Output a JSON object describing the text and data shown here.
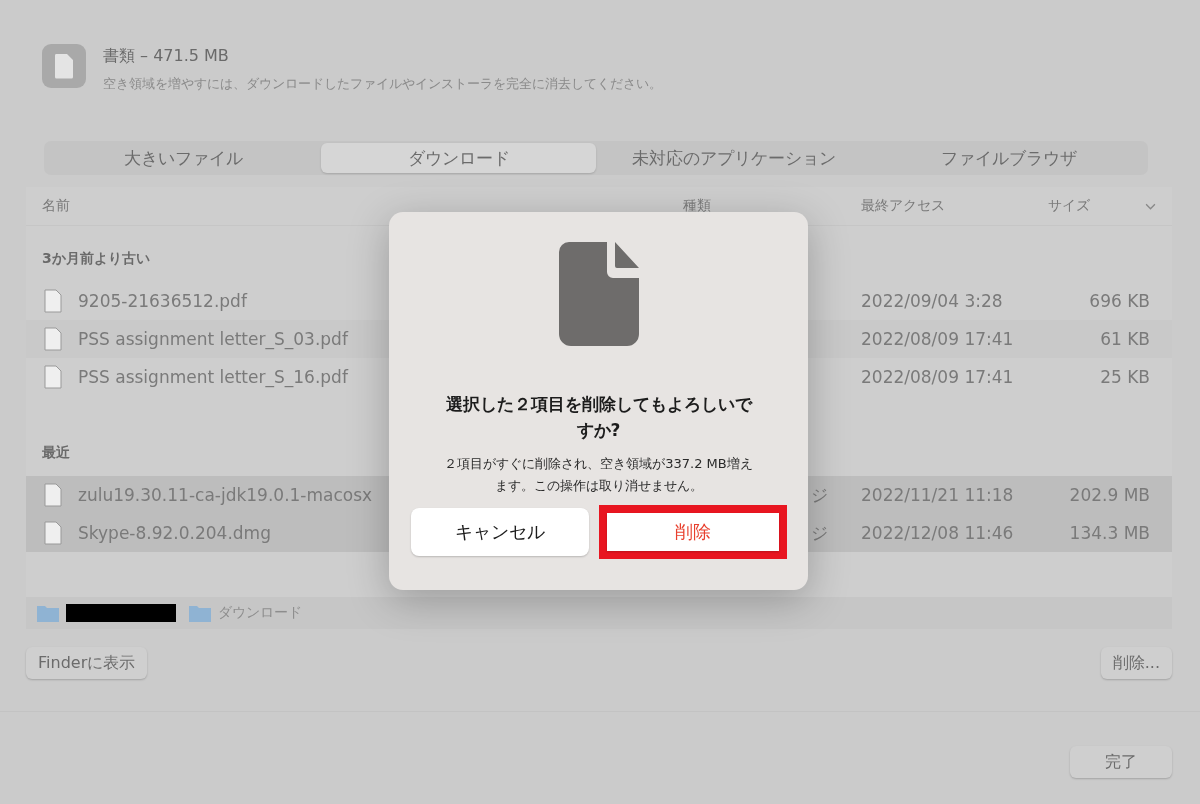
{
  "header": {
    "title": "書類 – 471.5 MB",
    "subtitle": "空き領域を増やすには、ダウンロードしたファイルやインストーラを完全に消去してください。"
  },
  "tabs": [
    {
      "label": "大きいファイル",
      "selected": false
    },
    {
      "label": "ダウンロード",
      "selected": true
    },
    {
      "label": "未対応のアプリケーション",
      "selected": false
    },
    {
      "label": "ファイルブラウザ",
      "selected": false
    }
  ],
  "table": {
    "columns": [
      "名前",
      "種類",
      "最終アクセス",
      "サイズ"
    ],
    "groups": [
      {
        "title": "3か月前より古い",
        "rows": [
          {
            "name": "9205-21636512.pdf",
            "kind": "",
            "accessed": "2022/09/04 3:28",
            "size": "696 KB",
            "selected": false
          },
          {
            "name": "PSS assignment letter_S_03.pdf",
            "kind": "",
            "accessed": "2022/08/09 17:41",
            "size": "61 KB",
            "selected": false
          },
          {
            "name": "PSS assignment letter_S_16.pdf",
            "kind": "",
            "accessed": "2022/08/09 17:41",
            "size": "25 KB",
            "selected": false
          }
        ]
      },
      {
        "title": "最近",
        "rows": [
          {
            "name": "zulu19.30.11-ca-jdk19.0.1-macosx",
            "kind": "ジ",
            "accessed": "2022/11/21 11:18",
            "size": "202.9 MB",
            "selected": true
          },
          {
            "name": "Skype-8.92.0.204.dmg",
            "kind": "ジ",
            "accessed": "2022/12/08 11:46",
            "size": "134.3 MB",
            "selected": true
          }
        ]
      }
    ]
  },
  "path_bar": {
    "folder": "ダウンロード"
  },
  "buttons": {
    "show_in_finder": "Finderに表示",
    "delete": "削除...",
    "done": "完了"
  },
  "dialog": {
    "title": "選択した２項目を削除してもよろしいですか?",
    "message": "２項目がすぐに削除され、空き領域が337.2 MB増えます。この操作は取り消せません。",
    "cancel": "キャンセル",
    "confirm": "削除",
    "confirm_highlighted": true
  }
}
